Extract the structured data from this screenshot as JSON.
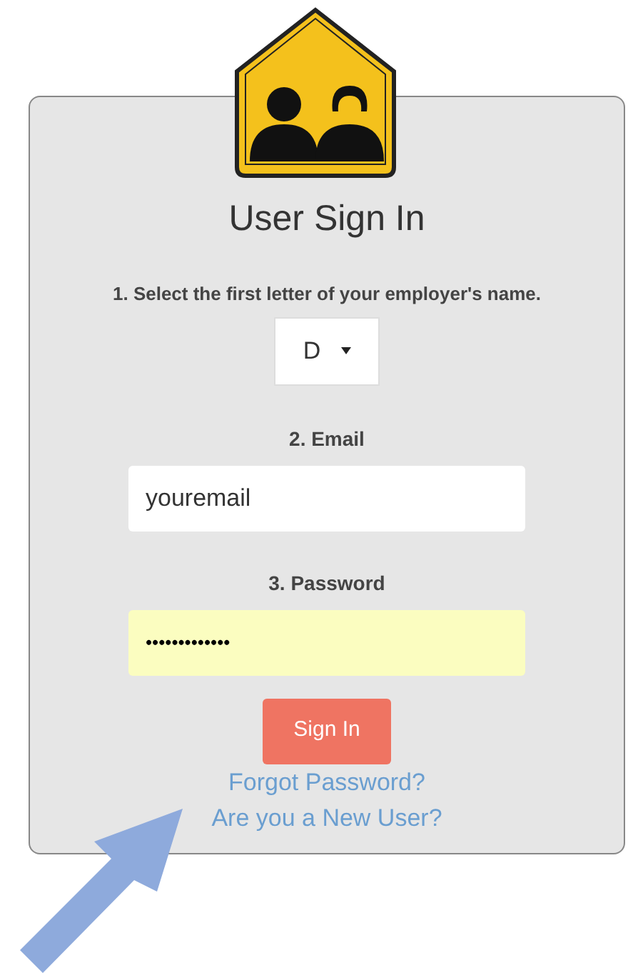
{
  "title": "User Sign In",
  "employer": {
    "label": "1. Select the first letter of your employer's name.",
    "value": "D"
  },
  "email": {
    "label": "2. Email",
    "value": "youremail"
  },
  "password": {
    "label": "3. Password",
    "value": "•••••••••••••",
    "autofilled": true
  },
  "sign_in_button": "Sign In",
  "links": [
    "Forgot Password?",
    "Are you a New User?"
  ]
}
